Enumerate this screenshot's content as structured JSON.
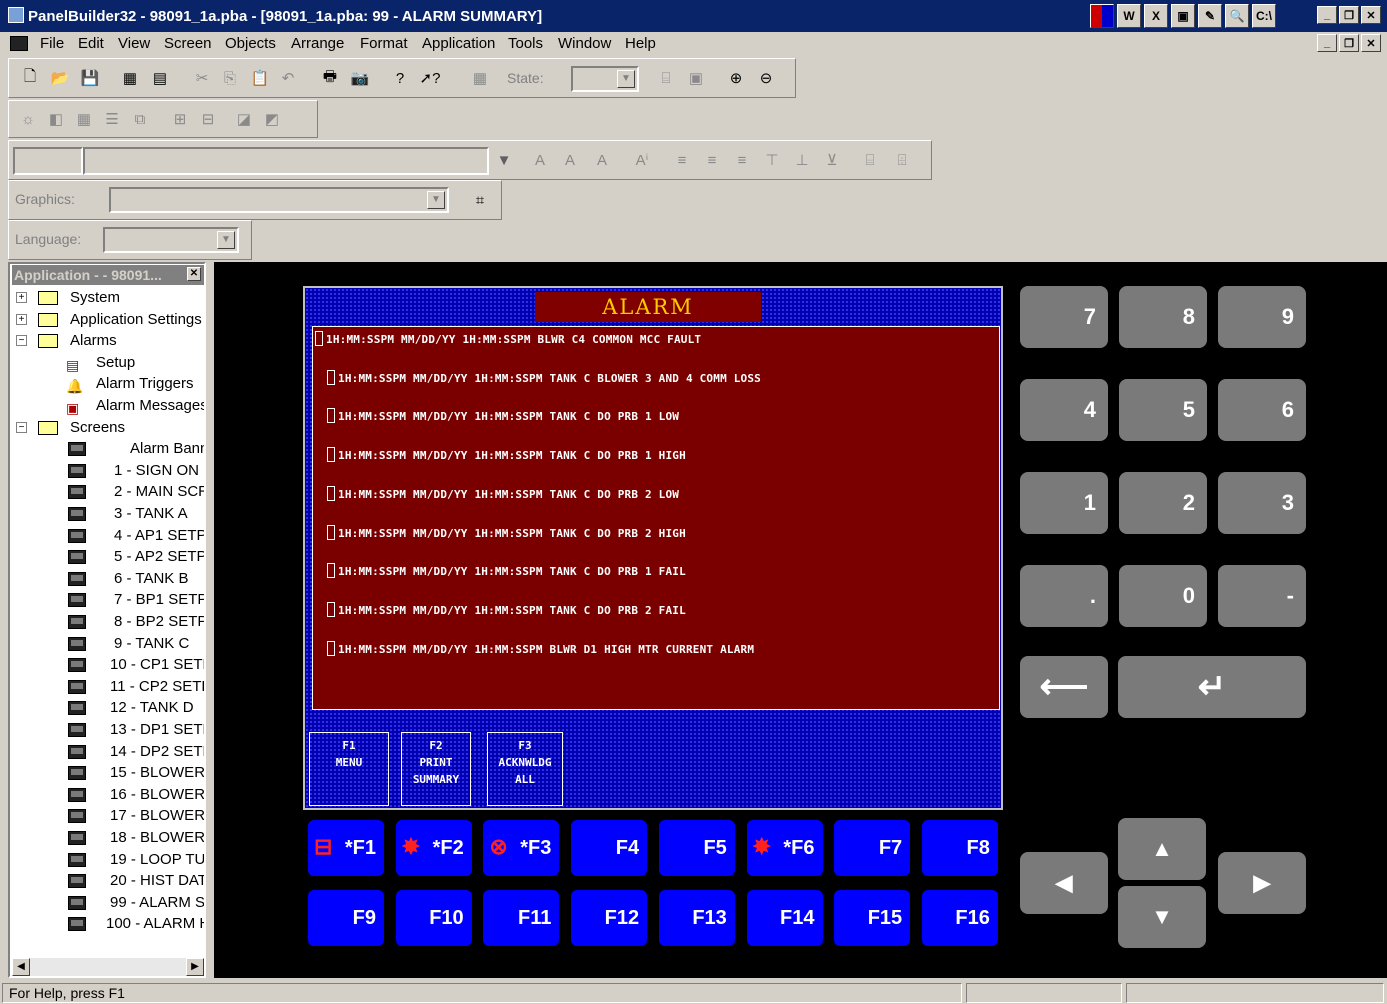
{
  "window": {
    "title": "PanelBuilder32 - 98091_1a.pba - [98091_1a.pba: 99 - ALARM SUMMARY]",
    "tray_icons": [
      "W",
      "X",
      "▣",
      "✎",
      "🔍",
      "C:\\"
    ]
  },
  "menu": [
    "File",
    "Edit",
    "View",
    "Screen",
    "Objects",
    "Arrange",
    "Format",
    "Application",
    "Tools",
    "Window",
    "Help"
  ],
  "toolbar": {
    "state_label": "State:",
    "graphics_label": "Graphics:",
    "language_label": "Language:"
  },
  "tree": {
    "header": "Application -  - 98091...",
    "items": [
      {
        "label": "System"
      },
      {
        "label": "Application Settings"
      },
      {
        "label": "Alarms"
      },
      {
        "label": "Setup"
      },
      {
        "label": "Alarm Triggers"
      },
      {
        "label": "Alarm Messages"
      },
      {
        "label": "Screens"
      },
      {
        "label": "Alarm Bann"
      },
      {
        "label": "1 - SIGN ON"
      },
      {
        "label": "2 - MAIN SCR"
      },
      {
        "label": "3 - TANK A"
      },
      {
        "label": "4 - AP1 SETP"
      },
      {
        "label": "5 - AP2 SETP"
      },
      {
        "label": "6 - TANK B"
      },
      {
        "label": "7 - BP1 SETP"
      },
      {
        "label": "8 - BP2 SETP"
      },
      {
        "label": "9 - TANK C"
      },
      {
        "label": "10 - CP1 SETF"
      },
      {
        "label": "11 - CP2 SETF"
      },
      {
        "label": "12 - TANK D"
      },
      {
        "label": "13 - DP1 SETF"
      },
      {
        "label": "14 - DP2 SETF"
      },
      {
        "label": "15 - BLOWER"
      },
      {
        "label": "16 - BLOWER"
      },
      {
        "label": "17 - BLOWER"
      },
      {
        "label": "18 - BLOWER"
      },
      {
        "label": "19 - LOOP TU"
      },
      {
        "label": "20 - HIST DAT"
      },
      {
        "label": "99 - ALARM S"
      },
      {
        "label": "100 - ALARM H"
      }
    ]
  },
  "panel": {
    "title": "ALARM  SUMMARY",
    "alarms": [
      "1H:MM:SSPM MM/DD/YY 1H:MM:SSPM BLWR C4 COMMON MCC FAULT",
      "1H:MM:SSPM MM/DD/YY 1H:MM:SSPM TANK C BLOWER 3 AND 4 COMM LOSS",
      "1H:MM:SSPM MM/DD/YY 1H:MM:SSPM TANK C DO PRB 1 LOW",
      "1H:MM:SSPM MM/DD/YY 1H:MM:SSPM TANK C DO PRB 1 HIGH",
      "1H:MM:SSPM MM/DD/YY 1H:MM:SSPM TANK C DO PRB 2 LOW",
      "1H:MM:SSPM MM/DD/YY 1H:MM:SSPM TANK C DO PRB 2 HIGH",
      "1H:MM:SSPM MM/DD/YY 1H:MM:SSPM TANK C DO PRB 1 FAIL",
      "1H:MM:SSPM MM/DD/YY 1H:MM:SSPM TANK C DO PRB 2 FAIL",
      "1H:MM:SSPM MM/DD/YY 1H:MM:SSPM BLWR D1 HIGH MTR CURRENT ALARM"
    ],
    "fkey_labels": [
      "F1\nMENU",
      "F2\nPRINT\nSUMMARY",
      "F3\nACKNWLDG\nALL"
    ]
  },
  "fkeys": [
    "*F1",
    "*F2",
    "*F3",
    "F4",
    "F5",
    "*F6",
    "F7",
    "F8",
    "F9",
    "F10",
    "F11",
    "F12",
    "F13",
    "F14",
    "F15",
    "F16"
  ],
  "keypad": [
    "7",
    "8",
    "9",
    "4",
    "5",
    "6",
    "1",
    "2",
    "3",
    ".",
    "0",
    "-"
  ],
  "status": {
    "text": "For Help, press F1"
  }
}
